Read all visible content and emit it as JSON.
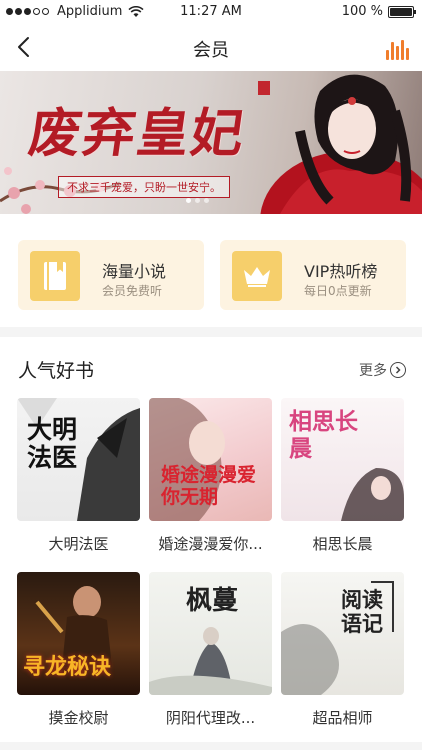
{
  "status_bar": {
    "carrier": "Applidium",
    "time": "11:27 AM",
    "battery": "100 %"
  },
  "nav": {
    "title": "会员"
  },
  "banner": {
    "title": "废弃皇妃",
    "slogan": "不求三千宠爱，只盼一世安宁。"
  },
  "quick_entries": [
    {
      "title": "海量小说",
      "subtitle": "会员免费听",
      "icon": "book-icon"
    },
    {
      "title": "VIP热听榜",
      "subtitle": "每日0点更新",
      "icon": "crown-icon"
    }
  ],
  "section": {
    "title": "人气好书",
    "more": "更多"
  },
  "books": [
    {
      "title": "大明法医",
      "cover_text": "大明法医"
    },
    {
      "title": "婚途漫漫爱你...",
      "cover_text": "婚途漫漫爱你无期"
    },
    {
      "title": "相思长晨",
      "cover_text": "相思长晨"
    },
    {
      "title": "摸金校尉",
      "cover_text": "寻龙秘诀"
    },
    {
      "title": "阴阳代理改...",
      "cover_text": "枫蔓"
    },
    {
      "title": "超品相师",
      "cover_text": "阅读语记"
    }
  ],
  "colors": {
    "accent": "#f07d2c",
    "quick_bg": "#fdf3e1",
    "quick_icon": "#f6cf6b",
    "banner_red": "#b31b25"
  }
}
